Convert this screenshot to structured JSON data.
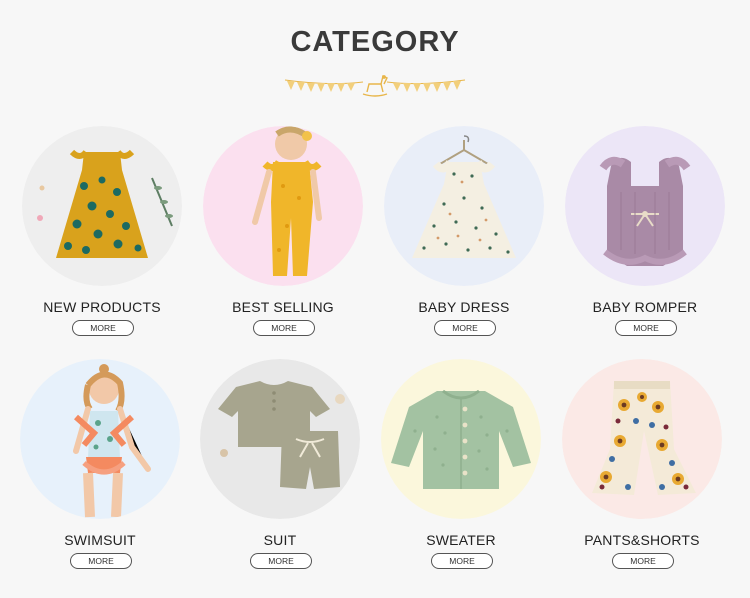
{
  "page": {
    "title": "CATEGORY"
  },
  "colors": {
    "accent_gold": "#e8b64a",
    "circle_new": "#eeeeee",
    "circle_best": "#fbe0ef",
    "circle_dress": "#e9eef8",
    "circle_romper": "#ece6f7",
    "circle_swim": "#e7f1fb",
    "circle_suit": "#e8e8e8",
    "circle_sweater": "#fbf7dc",
    "circle_pants": "#fbe9e6"
  },
  "categories": [
    {
      "label": "NEW PRODUCTS",
      "more": "MORE"
    },
    {
      "label": "BEST SELLING",
      "more": "MORE"
    },
    {
      "label": "BABY DRESS",
      "more": "MORE"
    },
    {
      "label": "BABY ROMPER",
      "more": "MORE"
    },
    {
      "label": "SWIMSUIT",
      "more": "MORE"
    },
    {
      "label": "SUIT",
      "more": "MORE"
    },
    {
      "label": "SWEATER",
      "more": "MORE"
    },
    {
      "label": "PANTS&SHORTS",
      "more": "MORE"
    }
  ]
}
